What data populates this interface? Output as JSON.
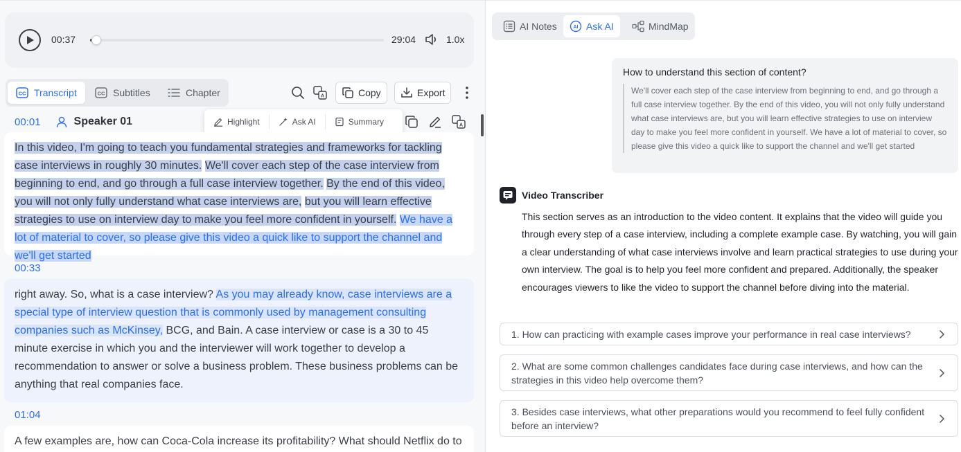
{
  "player": {
    "current_time": "00:37",
    "total_time": "29:04",
    "speed": "1.0x",
    "progress_fraction": 0.021
  },
  "left_tabs": [
    {
      "label": "Transcript",
      "icon": "cc-icon",
      "active": true
    },
    {
      "label": "Subtitles",
      "icon": "cc-icon",
      "active": false
    },
    {
      "label": "Chapter",
      "icon": "list-icon",
      "active": false
    }
  ],
  "toolbar": {
    "copy_label": "Copy",
    "export_label": "Export"
  },
  "selection_popup": {
    "highlight_label": "Highlight",
    "ask_ai_label": "Ask AI",
    "summary_label": "Summary"
  },
  "segments": [
    {
      "time": "00:01",
      "speaker": "Speaker 01",
      "parts": [
        "In this video, I'm going to teach you fundamental strategies and frameworks for tackling case interviews in roughly 30 minutes.",
        "We'll cover each step of the case interview from beginning to end, and go through a full case interview together.",
        "By the end of this video, you will not only fully understand what case interviews are,",
        "but you will learn effective strategies to use on interview day to make you feel more confident in yourself.",
        "We have a lot of material to cover, so please give this video a quick like to support the channel and we'll get started"
      ]
    },
    {
      "time": "00:33",
      "parts": [
        "right away. So, what is a case interview?",
        "As you may already know, case interviews are a special type of interview question that is commonly used by management consulting companies such as McKinsey,",
        "BCG, and Bain. A case interview or case is a 30 to 45 minute exercise in which you and the interviewer will work together to develop a recommendation to answer or solve a business problem. These business problems can be anything that real companies face."
      ]
    },
    {
      "time": "01:04",
      "text": "A few examples are, how can Coca-Cola increase its profitability? What should Netflix do to"
    }
  ],
  "right_tabs": [
    {
      "label": "AI Notes",
      "icon": "notes-icon",
      "active": false
    },
    {
      "label": "Ask AI",
      "icon": "ai-icon",
      "active": true
    },
    {
      "label": "MindMap",
      "icon": "mindmap-icon",
      "active": false
    }
  ],
  "question": {
    "title": "How to understand this section of content?",
    "quote": "We'll cover each step of the case interview from beginning to end, and go through a full case interview together. By the end of this video, you will not only fully understand what case interviews are, but you will learn effective strategies to use on interview day to make you feel more confident in yourself. We have a lot of material to cover, so please give this video a quick like to support the channel and we'll get started"
  },
  "answer": {
    "bot_name": "Video Transcriber",
    "text": "This section serves as an introduction to the video content. It explains that the video will guide you through every step of a case interview, including a complete example case. By watching, you will gain a clear understanding of what case interviews involve and learn practical strategies to use during your own interview. The goal is to help you feel more confident and prepared. Additionally, the speaker encourages viewers to like the video to support the channel before diving into the material."
  },
  "suggestions": [
    "1. How can practicing with example cases improve your performance in real case interviews?",
    "2. What are some common challenges candidates face during case interviews, and how can the strategies in this video help overcome them?",
    "3. Besides case interviews, what other preparations would you recommend to feel fully confident before an interview?"
  ],
  "colors": {
    "accent": "#2a6ef2",
    "highlight_selected": "#c4d1ee",
    "segment_active_bg": "#edf2fc"
  }
}
